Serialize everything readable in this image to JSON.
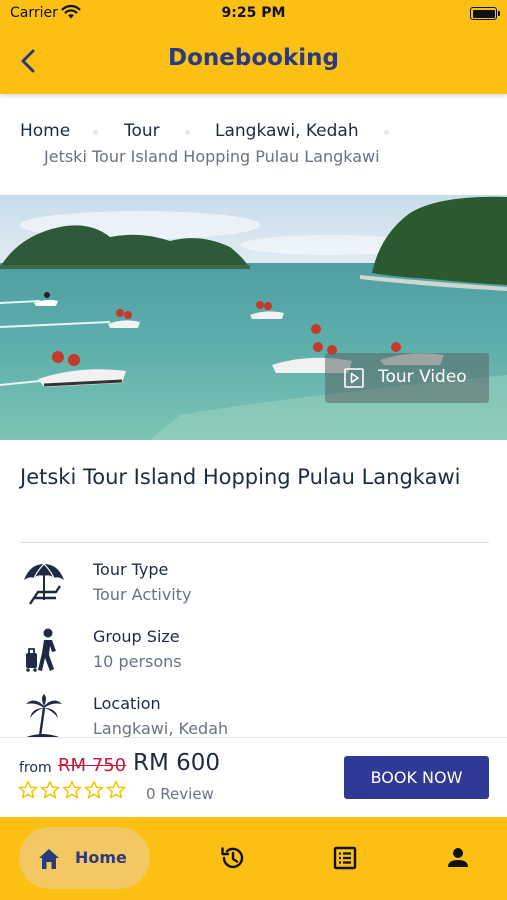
{
  "status_bar": {
    "carrier": "Carrier",
    "time": "9:25 PM"
  },
  "app_bar": {
    "title": "Donebooking"
  },
  "breadcrumb": {
    "items": [
      "Home",
      "Tour",
      "Langkawi, Kedah"
    ],
    "current": "Jetski Tour Island Hopping Pulau Langkawi"
  },
  "hero": {
    "video_button_label": "Tour Video"
  },
  "tour": {
    "title": "Jetski Tour Island Hopping Pulau Langkawi",
    "info": [
      {
        "label": "Tour Type",
        "value": "Tour Activity",
        "icon": "beach-umbrella-icon"
      },
      {
        "label": "Group Size",
        "value": "10 persons",
        "icon": "traveler-icon"
      },
      {
        "label": "Location",
        "value": "Langkawi, Kedah",
        "icon": "palm-island-icon"
      }
    ]
  },
  "booking": {
    "from_label": "from",
    "old_price": "RM 750",
    "price": "RM 600",
    "rating_stars": 0,
    "rating_max": 5,
    "reviews": "0 Review",
    "book_button": "BOOK NOW"
  },
  "tab_bar": {
    "tabs": [
      {
        "label": "Home",
        "icon": "home-icon",
        "active": true
      },
      {
        "label": "",
        "icon": "history-icon",
        "active": false
      },
      {
        "label": "",
        "icon": "bookings-list-icon",
        "active": false
      },
      {
        "label": "",
        "icon": "profile-icon",
        "active": false
      }
    ]
  },
  "colors": {
    "brand_yellow": "#fcc015",
    "brand_navy": "#2b3a7c",
    "button_blue": "#2e3a95",
    "old_price_red": "#c5183c"
  }
}
